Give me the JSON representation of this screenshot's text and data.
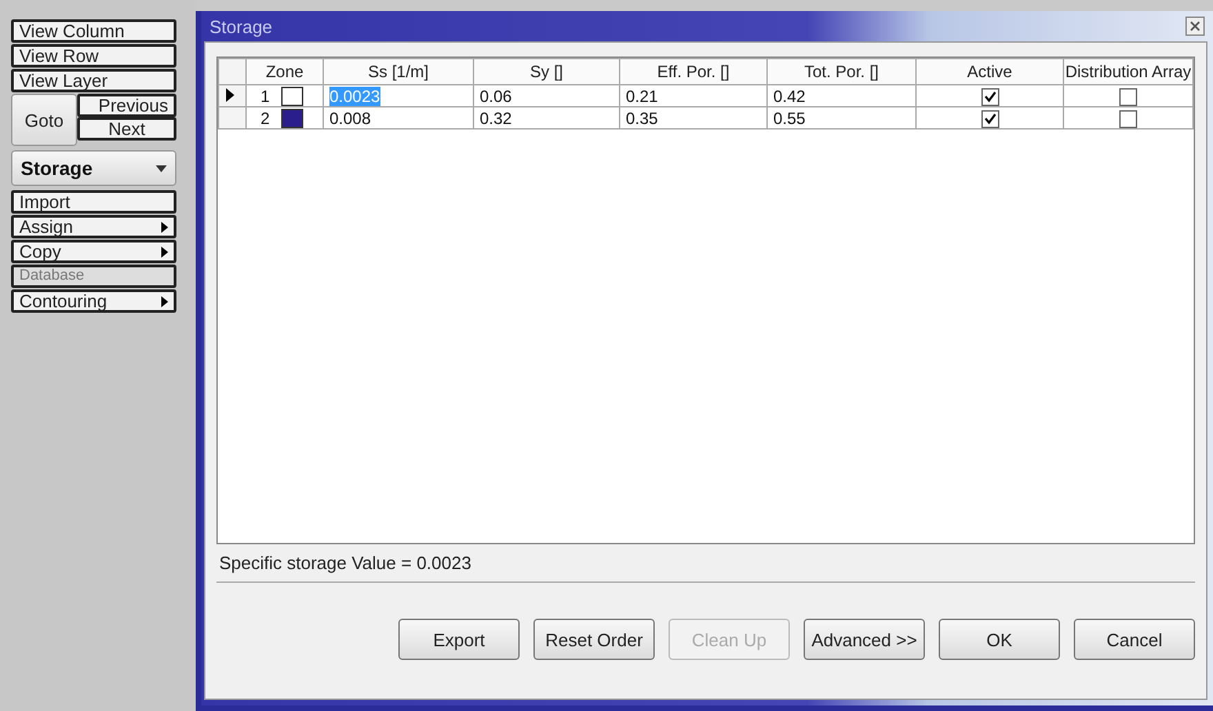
{
  "sidebar": {
    "items": [
      {
        "kind": "button",
        "label": "View Column",
        "disabled": false
      },
      {
        "kind": "button",
        "label": "View Row",
        "disabled": false
      },
      {
        "kind": "button",
        "label": "View Layer",
        "disabled": false
      },
      {
        "kind": "goto",
        "label": "Goto",
        "buttons": [
          "Previous",
          "Next"
        ],
        "disabled": false
      },
      {
        "kind": "dropdown",
        "label": "Storage",
        "disabled": false
      },
      {
        "kind": "button",
        "label": "Import",
        "disabled": false
      },
      {
        "kind": "submenu",
        "label": "Assign",
        "disabled": false
      },
      {
        "kind": "submenu",
        "label": "Copy",
        "disabled": false
      },
      {
        "kind": "button",
        "label": "Database",
        "disabled": true
      },
      {
        "kind": "submenu",
        "label": "Contouring",
        "disabled": false
      }
    ]
  },
  "window": {
    "title": "Storage"
  },
  "table": {
    "columns": [
      "Zone",
      "Ss [1/m]",
      "Sy []",
      "Eff. Por. []",
      "Tot. Por. []",
      "Active",
      "Distribution Array"
    ],
    "rows": [
      {
        "current": true,
        "zone": "1",
        "color": "#ffffff",
        "ss": "0.0023",
        "ss_selected": true,
        "sy": "0.06",
        "eff": "0.21",
        "tot": "0.42",
        "active": true,
        "distribution": false
      },
      {
        "current": false,
        "zone": "2",
        "color": "#2a1f8a",
        "ss": "0.008",
        "ss_selected": false,
        "sy": "0.32",
        "eff": "0.35",
        "tot": "0.55",
        "active": true,
        "distribution": false
      }
    ]
  },
  "status": "Specific storage Value = 0.0023",
  "buttons": [
    {
      "label": "Export",
      "disabled": false
    },
    {
      "label": "Reset Order",
      "disabled": false
    },
    {
      "label": "Clean Up",
      "disabled": true
    },
    {
      "label": "Advanced >>",
      "disabled": false
    },
    {
      "label": "OK",
      "disabled": false
    },
    {
      "label": "Cancel",
      "disabled": false
    }
  ]
}
